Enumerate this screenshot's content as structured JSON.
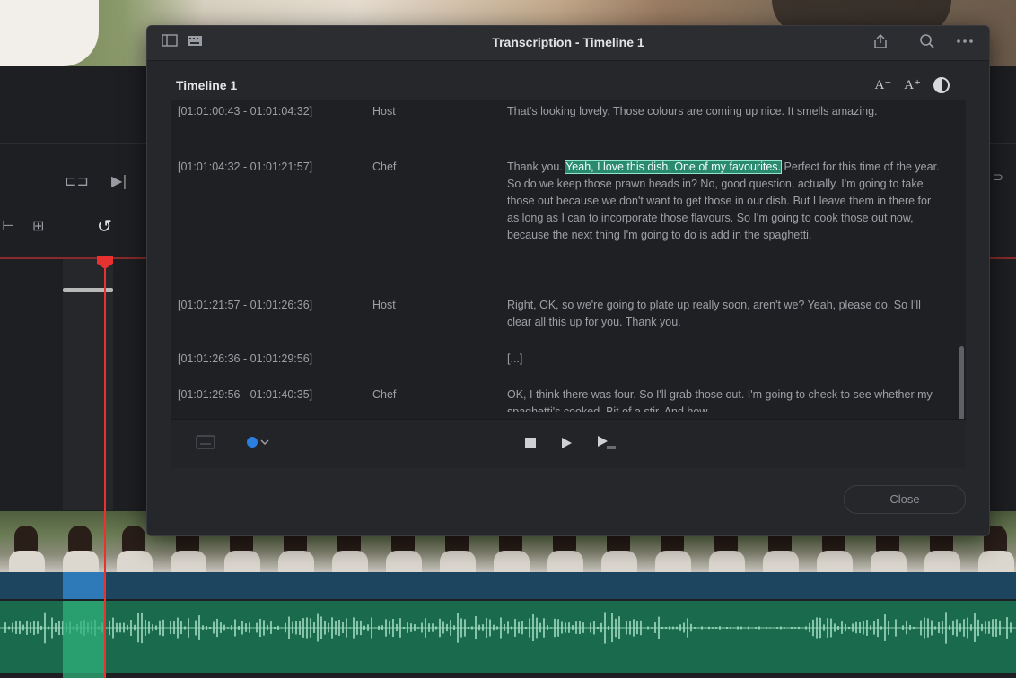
{
  "dialog": {
    "title": "Transcription - Timeline 1",
    "timeline_name": "Timeline 1",
    "close_label": "Close",
    "font_decrease_label": "A⁻",
    "font_increase_label": "A⁺"
  },
  "transcript": [
    {
      "timecode": "[01:01:00:43 - 01:01:04:32]",
      "speaker": "Host",
      "text_before": "That's looking lovely. Those colours are coming up nice. It smells amazing.",
      "highlight": "",
      "text_after": ""
    },
    {
      "timecode": "[01:01:04:32 - 01:01:21:57]",
      "speaker": "Chef",
      "text_before": "Thank you. ",
      "highlight": "Yeah, I love this dish. One of my favourites.",
      "text_after": " Perfect for this time of the year. So do we keep those prawn heads in? No, good question, actually. I'm going to take those out because we don't want to get those in our dish. But I leave them in there for as long as I can to incorporate those flavours. So I'm going to cook those out now, because the next thing I'm going to do is add in the spaghetti."
    },
    {
      "timecode": "[01:01:21:57 - 01:01:26:36]",
      "speaker": "Host",
      "text_before": "Right, OK, so we're going to plate up really soon, aren't we? Yeah, please do. So I'll clear all this up for you. Thank you.",
      "highlight": "",
      "text_after": ""
    },
    {
      "timecode": "[01:01:26:36 - 01:01:29:56]",
      "speaker": "",
      "text_before": "[...]",
      "highlight": "",
      "text_after": ""
    },
    {
      "timecode": "[01:01:29:56 - 01:01:40:35]",
      "speaker": "Chef",
      "text_before": "OK, I think there was four. So I'll grab those out. I'm going to check to see whether my spaghetti's cooked. Bit of a stir. And how",
      "highlight": "",
      "text_after": ""
    }
  ],
  "icons": {
    "titlebar_left": [
      "sidebar-toggle-icon",
      "keyboard-icon"
    ],
    "titlebar_right": [
      "export-icon",
      "search-icon",
      "more-options-icon"
    ],
    "controls": [
      "captions-icon",
      "speaker-color-dropdown",
      "stop-icon",
      "play-icon",
      "play-selection-icon"
    ]
  },
  "colors": {
    "highlight": "#2a8a6f",
    "playhead": "#e8322f",
    "speaker_dot": "#2b7fe0"
  }
}
